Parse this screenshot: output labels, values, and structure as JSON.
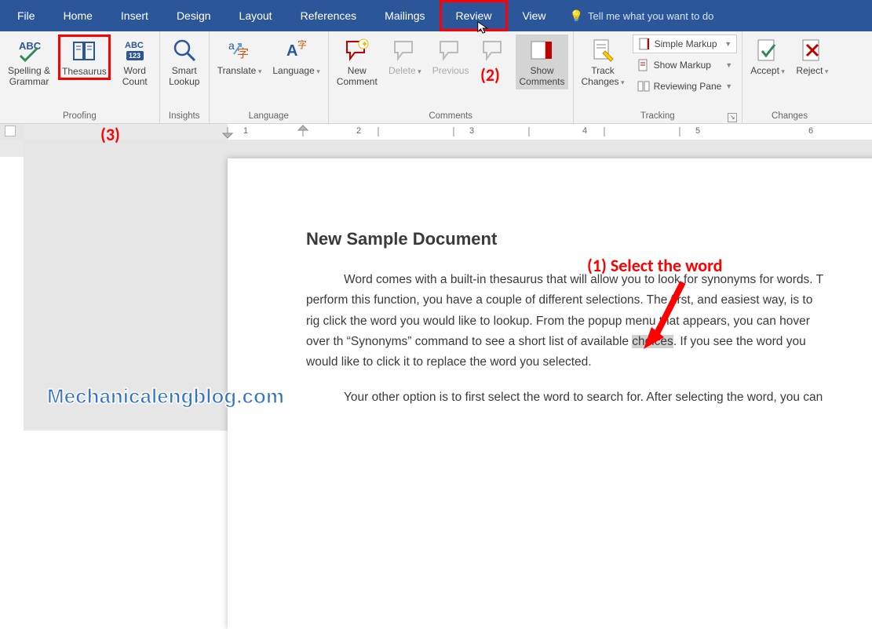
{
  "tabs": {
    "file": "File",
    "home": "Home",
    "insert": "Insert",
    "design": "Design",
    "layout": "Layout",
    "references": "References",
    "mailings": "Mailings",
    "review": "Review",
    "view": "View",
    "tellme": "Tell me what you want to do"
  },
  "ribbon": {
    "proofing": {
      "label": "Proofing",
      "spelling": "Spelling &\nGrammar",
      "thesaurus": "Thesaurus",
      "wordcount": "Word\nCount"
    },
    "insights": {
      "label": "Insights",
      "smartlookup": "Smart\nLookup"
    },
    "language": {
      "label": "Language",
      "translate": "Translate",
      "language": "Language"
    },
    "comments": {
      "label": "Comments",
      "new": "New\nComment",
      "delete": "Delete",
      "previous": "Previous",
      "next": "",
      "show": "Show\nComments"
    },
    "tracking": {
      "label": "Tracking",
      "track": "Track\nChanges",
      "simple": "Simple Markup",
      "showmarkup": "Show Markup",
      "reviewing": "Reviewing Pane"
    },
    "changes": {
      "label": "Changes",
      "accept": "Accept",
      "reject": "Reject"
    }
  },
  "ruler_numbers": [
    "1",
    "2",
    "3",
    "4",
    "5",
    "6"
  ],
  "doc": {
    "title": "New Sample Document",
    "p1_a": "Word comes with a built-in thesaurus that will allow you to look for synonyms for words. T",
    "p1_b": "perform this function, you have a couple of different selections. The first, and easiest way, is to rig",
    "p1_c": "click the word you would like to lookup. From the popup menu that appears, you can hover over th",
    "p1_d": "“Synonyms” command to see a short list of available ",
    "p1_sel": "choices",
    "p1_e": ". If you see the word you would like to",
    "p1_f": "click it to replace the word you selected.",
    "p2_a": "Your other option is to first select the word to search for. After selecting the word, you can"
  },
  "annotations": {
    "one": "(1)  Select the word",
    "two": "(2)",
    "three": "(3)"
  },
  "watermark": "Mechanicalengblog.com"
}
